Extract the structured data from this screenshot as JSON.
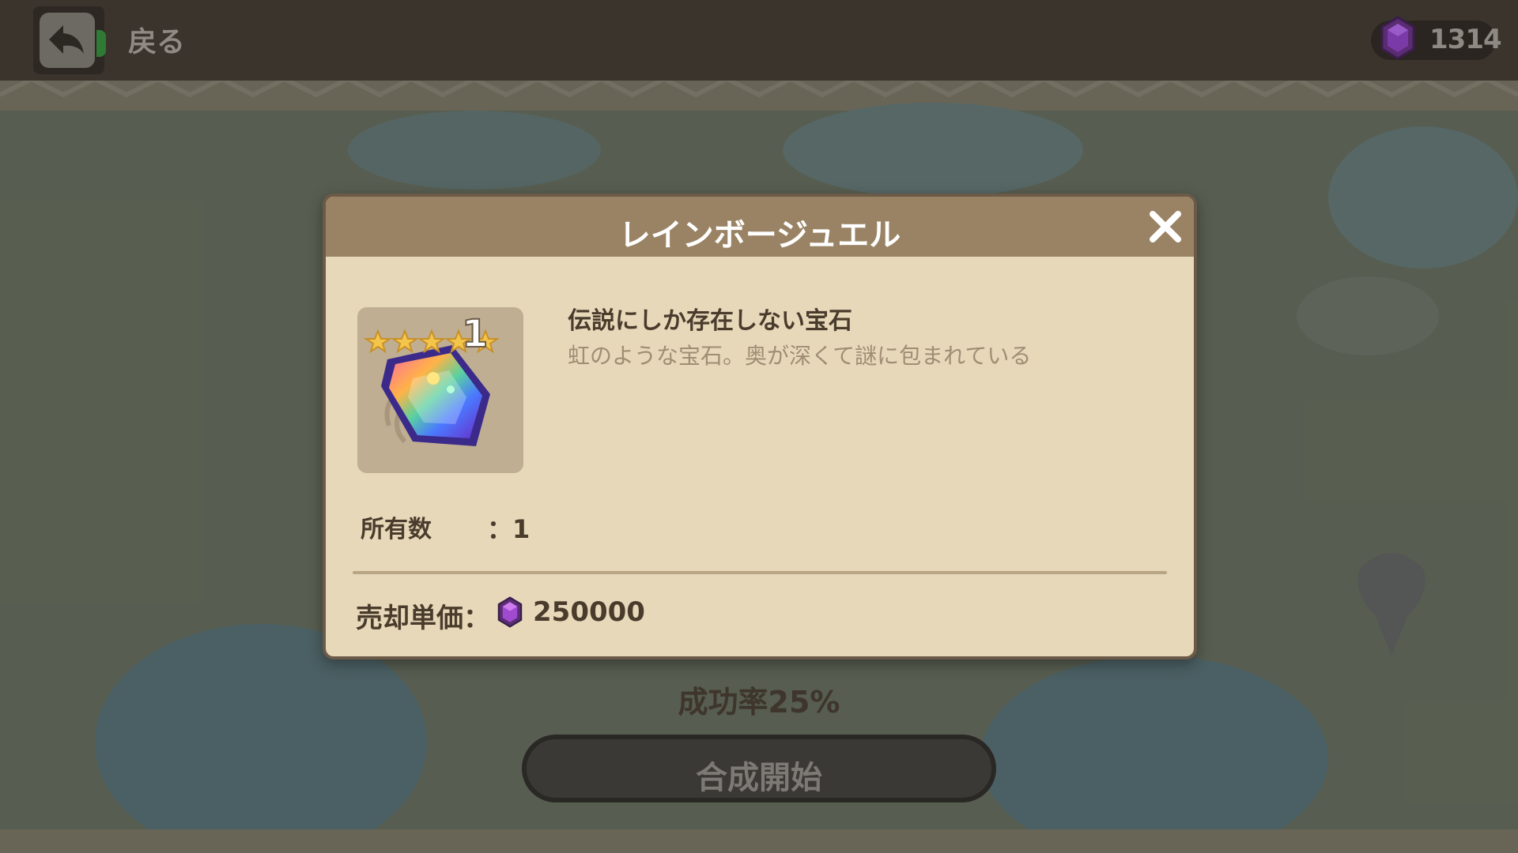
{
  "topbar": {
    "back_label": "戻る",
    "currency_value": "1314",
    "currency_icon": "purple-gem-icon"
  },
  "dialog": {
    "title": "レインボージュエル",
    "item": {
      "icon": "rainbow-jewel-icon",
      "stars": 5,
      "quantity_badge": "1",
      "subtitle": "伝説にしか存在しない宝石",
      "description": "虹のような宝石。奥が深くて謎に包まれている"
    },
    "owned_label": "所有数",
    "owned_value": "：1",
    "sell_price_label": "売却単価：",
    "sell_price_icon": "purple-gem-icon",
    "sell_price_value": "250000"
  },
  "footer": {
    "success_rate": "成功率25%",
    "start_button_label": "合成開始"
  },
  "colors": {
    "dialog_bg": "#e7d8ba",
    "dialog_header": "#9a8364",
    "text_dark": "#4a3c2c",
    "gem_purple": "#7a3aa8",
    "topbar_bg": "#3a342d"
  }
}
